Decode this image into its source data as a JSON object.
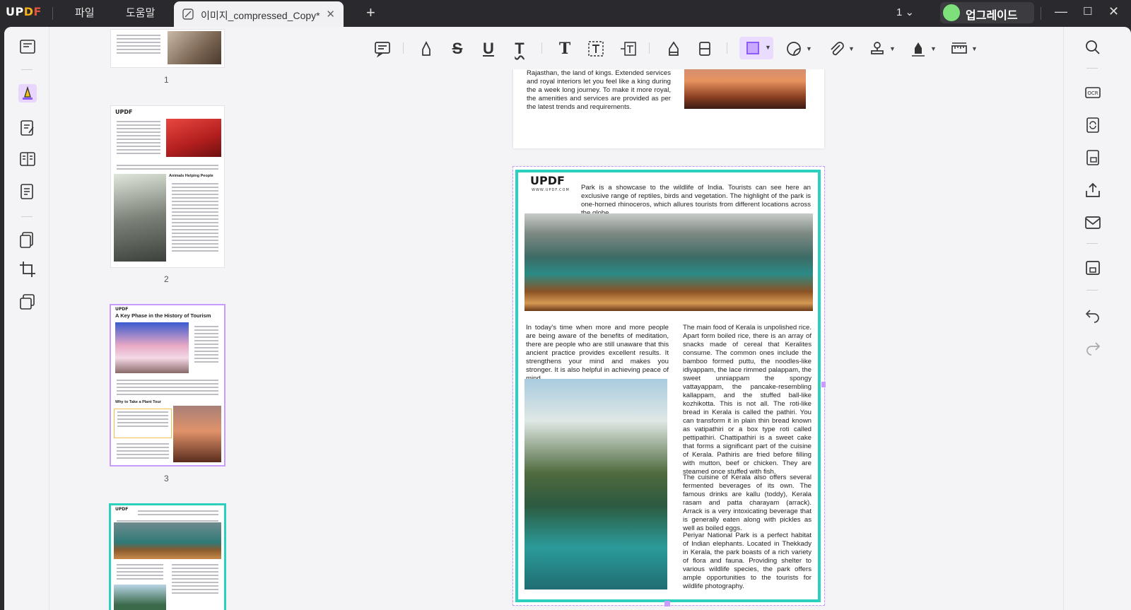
{
  "app": {
    "logo": "UPDF",
    "menus": [
      "파일",
      "도움말"
    ],
    "tab_title": "이미지_compressed_Copy*",
    "new_tab": "+",
    "page_indicator": "1",
    "upgrade_label": "업그레이드"
  },
  "thumbnails": {
    "page_labels": [
      "1",
      "2",
      "3"
    ],
    "page2_heading": "Animals Helping People",
    "page3_heading": "A Key Phase in the History of Tourism",
    "page3_subheading": "Why to Take a Plant Tour",
    "thumb_logo": "UPDF"
  },
  "document": {
    "prev_page_text": "Rajasthan, the land of kings. Extended services and royal interiors let you feel like a king during the a week long journey. To make it more royal, the amenities and services are provided as per the latest trends and requirements.",
    "logo": "UPDF",
    "logo_sub": "WWW.UPDF.COM",
    "intro_text": "Park is a showcase to the wildlife of India. Tourists can see here an exclusive range of reptiles, birds and vegetation. The highlight of the park is one-horned rhinoceros, which allures tourists from different locations across the globe.",
    "left_col_text": "In today's time when more and more people are being aware of the benefits of meditation, there are people who are still unaware that this ancient practice provides excellent results. It strengthens your mind and makes you stronger. It is also helpful in achieving peace of mind.",
    "right_col_p1": "The main food of Kerala is unpolished rice. Apart form boiled rice, there is an array of snacks made of cereal that Keralites consume. The common ones include the bamboo formed puttu, the noodles-like idiyappam, the lace rimmed palappam, the sweet unniappam the spongy vattayappam, the pancake-resembling kallappam, and the stuffed ball-like kozhikotta. This is not all. The roti-like bread in Kerala is called the pathiri. You can transform it in plain thin bread known as vatipathiri or a box type roti called pettipathiri. Chattipathiri is a sweet cake that forms a significant part of the cuisine of Kerala. Pathiris are fried before filling with mutton, beef or chicken. They are steamed once stuffed with fish.",
    "right_col_p2": "The cuisine of Kerala also offers several fermented beverages of its own. The famous drinks are kallu (toddy), Kerala rasam and patta charayam (arrack). Arrack is a very intoxicating beverage that is generally eaten along with pickles as well as boiled eggs.",
    "right_col_p3": "Periyar National Park is a perfect habitat of Indian elephants. Located in Thekkady in Kerala, the park boasts of a rich variety of flora and fauna. Providing shelter to various wildlife species, the park offers ample opportunities to the tourists for wildlife photography."
  },
  "colors": {
    "accent": "#a67cff",
    "selection": "#2bd1be",
    "titlebar": "#2a2a2e"
  }
}
